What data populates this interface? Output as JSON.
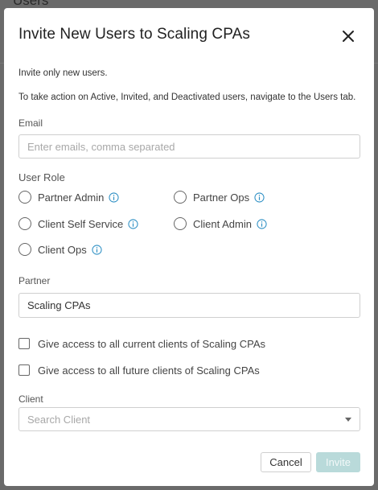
{
  "background": {
    "page_title": "Users"
  },
  "dialog": {
    "title": "Invite New Users to Scaling CPAs",
    "note_1": "Invite only new users.",
    "note_2": "To take action on Active, Invited, and Deactivated users, navigate to the Users tab.",
    "email": {
      "label": "Email",
      "placeholder": "Enter emails, comma separated",
      "value": ""
    },
    "user_role": {
      "label": "User Role",
      "options": [
        {
          "label": "Partner Admin",
          "has_info": true,
          "selected": false
        },
        {
          "label": "Partner Ops",
          "has_info": true,
          "selected": false
        },
        {
          "label": "Client Self Service",
          "has_info": true,
          "selected": false
        },
        {
          "label": "Client Admin",
          "has_info": true,
          "selected": false
        },
        {
          "label": "Client Ops",
          "has_info": true,
          "selected": false
        }
      ]
    },
    "partner": {
      "label": "Partner",
      "value": "Scaling CPAs"
    },
    "access_current": {
      "label": "Give access to all current clients of Scaling CPAs",
      "checked": false
    },
    "access_future": {
      "label": "Give access to all future clients of Scaling CPAs",
      "checked": false
    },
    "client": {
      "label": "Client",
      "placeholder": "Search Client"
    },
    "cancel_label": "Cancel",
    "invite_label": "Invite"
  },
  "colors": {
    "accent": "#2d8fc4",
    "invite_disabled": "#b9dada",
    "overlay": "#6a6a6a"
  },
  "icons": {
    "close": "close-icon",
    "info": "info-icon",
    "dropdown": "chevron-down-icon"
  }
}
